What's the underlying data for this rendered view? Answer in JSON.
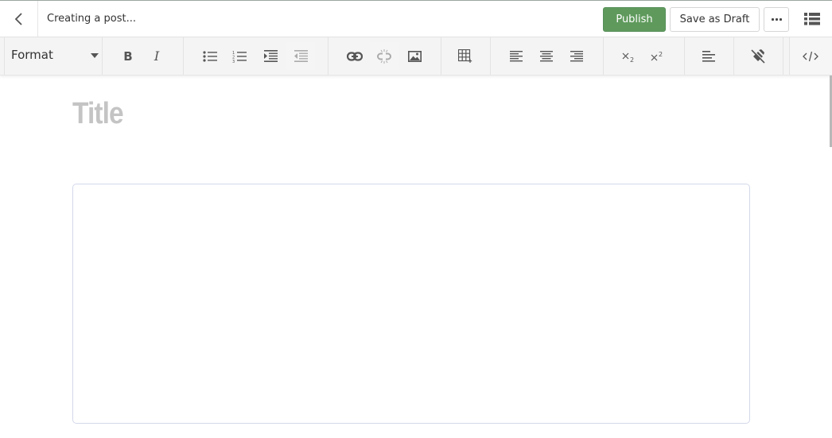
{
  "header": {
    "status_text": "Creating a post...",
    "publish_label": "Publish",
    "save_draft_label": "Save as Draft",
    "more_icon": "ellipsis-icon",
    "list_view_icon": "list-view-icon",
    "back_icon": "chevron-left-icon"
  },
  "toolbar": {
    "format_select": {
      "selected": "Format"
    },
    "buttons": [
      {
        "name": "bold",
        "glyph": "B"
      },
      {
        "name": "italic",
        "glyph": "I"
      },
      {
        "name": "bulleted-list",
        "icon": "bulleted-list-icon"
      },
      {
        "name": "numbered-list",
        "icon": "numbered-list-icon"
      },
      {
        "name": "indent",
        "icon": "indent-icon"
      },
      {
        "name": "outdent",
        "icon": "outdent-icon",
        "disabled": true
      },
      {
        "name": "insert-link",
        "icon": "link-icon"
      },
      {
        "name": "remove-link",
        "icon": "unlink-icon",
        "disabled": true
      },
      {
        "name": "insert-image",
        "icon": "image-icon"
      },
      {
        "name": "insert-table",
        "icon": "table-icon"
      },
      {
        "name": "align-left",
        "icon": "align-left-icon"
      },
      {
        "name": "align-center",
        "icon": "align-center-icon"
      },
      {
        "name": "align-right",
        "icon": "align-right-icon"
      },
      {
        "name": "subscript",
        "icon": "subscript-icon"
      },
      {
        "name": "superscript",
        "icon": "superscript-icon"
      },
      {
        "name": "paragraph-format",
        "icon": "paragraph-icon"
      },
      {
        "name": "clear-formatting",
        "icon": "eraser-icon"
      },
      {
        "name": "source-code",
        "icon": "code-icon"
      }
    ]
  },
  "editor": {
    "title_placeholder": "Title",
    "title_value": "",
    "body_value": ""
  },
  "colors": {
    "publish": "#5f9a5c",
    "toolbar_bg": "#f4f4f4",
    "title_placeholder": "#c4c4c4",
    "editor_border": "#d3d8ea"
  }
}
